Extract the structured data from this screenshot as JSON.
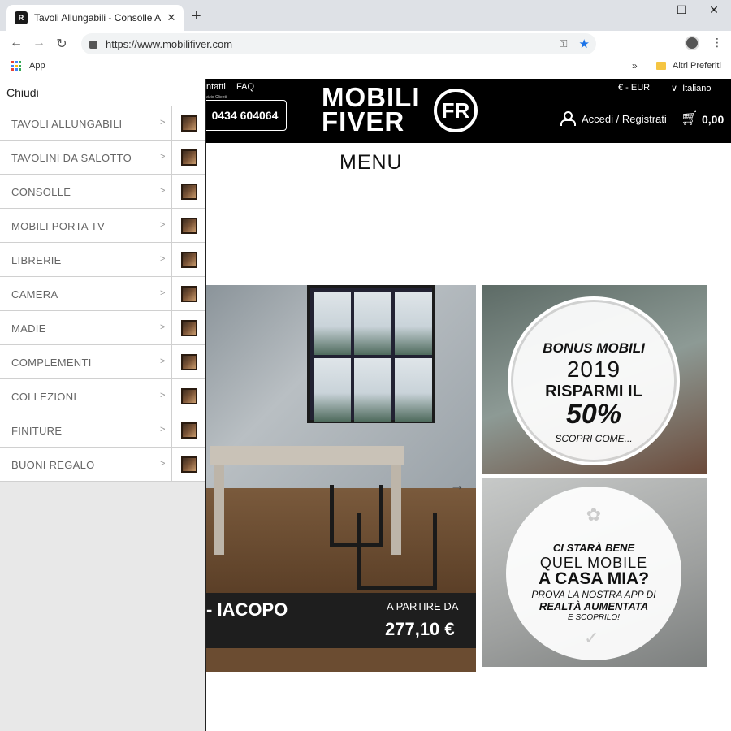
{
  "browser": {
    "tab_title": "Tavoli Allungabili - Consolle Allu",
    "tab_close": "✕",
    "new_tab": "+",
    "url": "https://www.mobilifiver.com",
    "window_controls": [
      "—",
      "☐",
      "✕"
    ],
    "bookmarks": {
      "apps_label": "App",
      "more": "»",
      "other_label": "Altri Preferiti"
    }
  },
  "site": {
    "header": {
      "links": [
        "ntatti",
        "FAQ"
      ],
      "service_label": "rvizio Clienti",
      "phone": "0434 604064",
      "logo_line1": "MOBILI",
      "logo_line2": "FIVER",
      "logo_badge": "FR",
      "currency": "€ - EUR",
      "language": "Italiano",
      "login": "Accedi / Registrati",
      "cart_total": "0,00"
    },
    "menu_title": "MENU",
    "hero": {
      "name": "- IACOPO",
      "price_prefix": "A PARTIRE DA",
      "price": "277,10 €"
    },
    "promo1": {
      "line1": "BONUS MOBILI",
      "line2": "2019",
      "line3": "RISPARMI IL",
      "line4": "50%",
      "line5": "SCOPRI COME..."
    },
    "promo2": {
      "line1": "CI STARÀ BENE",
      "line2": "QUEL MOBILE",
      "line3": "A CASA MIA?",
      "line4": "PROVA LA NOSTRA APP DI",
      "line5": "REALTÀ AUMENTATA",
      "line6": "E SCOPRILO!"
    }
  },
  "sidebar": {
    "close_label": "Chiudi",
    "items": [
      {
        "label": "TAVOLI ALLUNGABILI"
      },
      {
        "label": "TAVOLINI DA SALOTTO"
      },
      {
        "label": "CONSOLLE"
      },
      {
        "label": "MOBILI PORTA TV"
      },
      {
        "label": "LIBRERIE"
      },
      {
        "label": "CAMERA"
      },
      {
        "label": "MADIE"
      },
      {
        "label": "COMPLEMENTI"
      },
      {
        "label": "COLLEZIONI"
      },
      {
        "label": "FINITURE"
      },
      {
        "label": "BUONI REGALO"
      }
    ],
    "chevron": ">"
  }
}
